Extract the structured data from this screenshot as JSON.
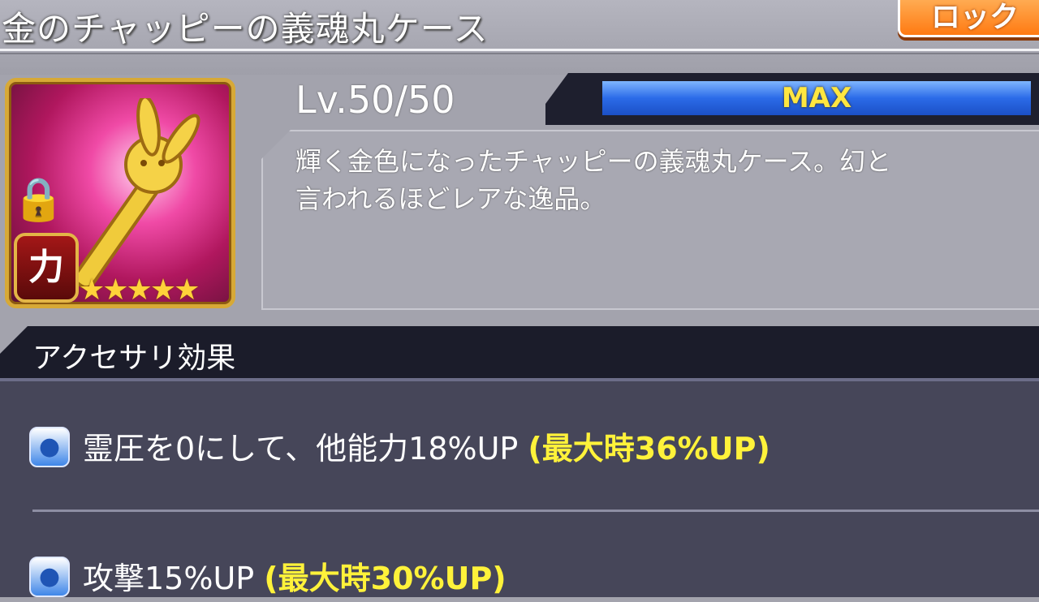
{
  "header": {
    "title": "金のチャッピーの義魂丸ケース",
    "lock_button_label": "ロック"
  },
  "item": {
    "attribute_badge": "力",
    "stars": "★★★★★",
    "level": "Lv.50/50",
    "level_bar_label": "MAX",
    "description_line1": "輝く金色になったチャッピーの義魂丸ケース。幻と",
    "description_line2": "言われるほどレアな逸品。"
  },
  "effects": {
    "section_title": "アクセサリ効果",
    "rows": [
      {
        "text": "霊圧を0にして、他能力18%UP ",
        "max": "(最大時36%UP)"
      },
      {
        "text": "攻撃15%UP ",
        "max": "(最大時30%UP)"
      }
    ]
  }
}
